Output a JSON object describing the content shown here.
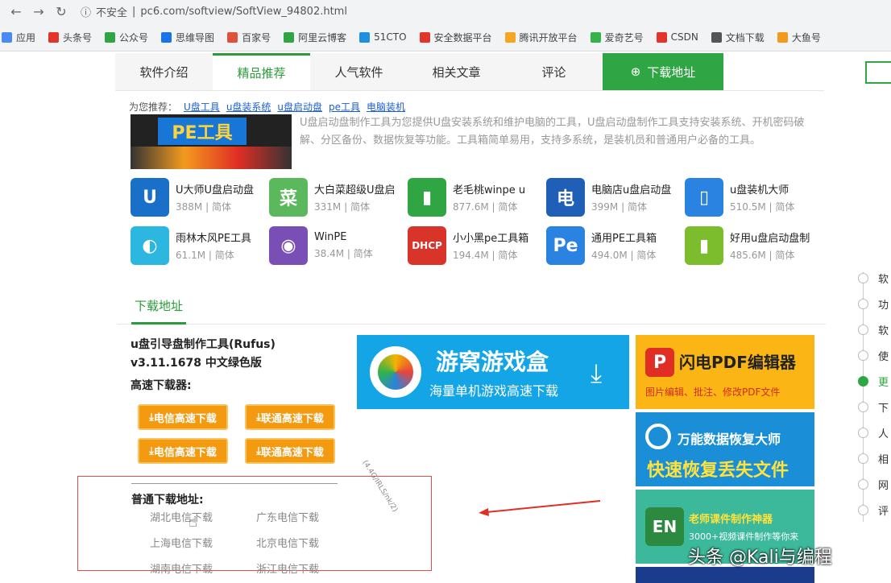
{
  "browser": {
    "security": "不安全",
    "url": "pc6.com/softview/SoftView_94802.html",
    "bookmarks": [
      {
        "label": "应用",
        "color": "#4a8af4"
      },
      {
        "label": "头条号",
        "color": "#e2342a"
      },
      {
        "label": "公众号",
        "color": "#2fa643"
      },
      {
        "label": "思维导图",
        "color": "#1a73e8"
      },
      {
        "label": "百家号",
        "color": "#e0513b"
      },
      {
        "label": "阿里云博客",
        "color": "#2fa643"
      },
      {
        "label": "51CTO",
        "color": "#1f8fe0"
      },
      {
        "label": "安全数据平台",
        "color": "#e2342a"
      },
      {
        "label": "腾讯开放平台",
        "color": "#f5a623"
      },
      {
        "label": "爱奇艺号",
        "color": "#36b24a"
      },
      {
        "label": "CSDN",
        "color": "#e2342a"
      },
      {
        "label": "文档下载",
        "color": "#555555"
      },
      {
        "label": "大鱼号",
        "color": "#f39a1e"
      }
    ]
  },
  "tabs": [
    {
      "label": "软件介绍"
    },
    {
      "label": "精品推荐"
    },
    {
      "label": "人气软件"
    },
    {
      "label": "相关文章"
    },
    {
      "label": "评论"
    },
    {
      "label": "下载地址"
    }
  ],
  "tags": {
    "prefix": "为您推荐：",
    "items": [
      "U盘工具",
      "u盘装系统",
      "u盘启动盘",
      "pe工具",
      "电脑装机"
    ]
  },
  "banner": {
    "text": "PE工具"
  },
  "description": "U盘启动盘制作工具为您提供U盘安装系统和维护电脑的工具，U盘启动盘制作工具支持安装系统、开机密码破解、分区备份、数据恢复等功能。工具箱简单易用，支持多系统，是装机员和普通用户必备的工具。",
  "apps": [
    {
      "name": "U大师U盘启动盘",
      "size": "388M",
      "lang": "简体",
      "icon_color": "#1a6fc9",
      "glyph": "U"
    },
    {
      "name": "大白菜超级U盘启",
      "size": "331M",
      "lang": "简体",
      "icon_color": "#5cb85c",
      "glyph": "菜"
    },
    {
      "name": "老毛桃winpe u",
      "size": "877.6M",
      "lang": "简体",
      "icon_color": "#2fa643",
      "glyph": "▮"
    },
    {
      "name": "电脑店u盘启动盘",
      "size": "399M",
      "lang": "简体",
      "icon_color": "#1f5fb8",
      "glyph": "电"
    },
    {
      "name": "u盘装机大师",
      "size": "510.5M",
      "lang": "简体",
      "icon_color": "#2a83e0",
      "glyph": "▯"
    },
    {
      "name": "雨林木风PE工具",
      "size": "61.1M",
      "lang": "简体",
      "icon_color": "#2bb7e0",
      "glyph": "◐"
    },
    {
      "name": "WinPE",
      "size": "38.4M",
      "lang": "简体",
      "icon_color": "#7a4fb5",
      "glyph": "◉"
    },
    {
      "name": "小小黑pe工具箱",
      "size": "194.4M",
      "lang": "简体",
      "icon_color": "#d9342a",
      "glyph": "DHCP"
    },
    {
      "name": "通用PE工具箱",
      "size": "494.0M",
      "lang": "简体",
      "icon_color": "#2a83e0",
      "glyph": "Pe"
    },
    {
      "name": "好用u盘启动盘制",
      "size": "485.6M",
      "lang": "简体",
      "icon_color": "#7cbd2e",
      "glyph": "▮"
    }
  ],
  "download": {
    "section_title": "下载地址",
    "product_title": "u盘引导盘制作工具(Rufus) v3.11.1678 中文绿色版",
    "fast_title": "高速下载器:",
    "buttons": [
      "电信高速下载",
      "联通高速下载",
      "电信高速下载",
      "联通高速下载"
    ],
    "normal_title": "普通下载地址:",
    "links": [
      "湖北电信下载",
      "广东电信下载",
      "上海电信下载",
      "北京电信下载",
      "湖南电信下载",
      "浙江电信下载"
    ],
    "rotated_note": "(4.4G/IRLS/nk/2)"
  },
  "ads": {
    "youwo": {
      "title": "游窝游戏盒",
      "subtitle": "海量单机游戏高速下载"
    },
    "pdf": {
      "logo": "P",
      "title": "闪电PDF编辑器",
      "subtitle": "图片编辑、批注、修改PDF文件"
    },
    "recover": {
      "title": "万能数据恢复大师",
      "subtitle": "快速恢复丢失文件"
    },
    "courseware": {
      "logo": "EN",
      "title": "老师课件制作神器",
      "subtitle": "3000+视频课件制作等你来"
    }
  },
  "sidebar_nav": [
    "软",
    "功",
    "软",
    "使",
    "更",
    "下",
    "人",
    "相",
    "网",
    "评"
  ],
  "watermark": "头条 @Kali与编程"
}
